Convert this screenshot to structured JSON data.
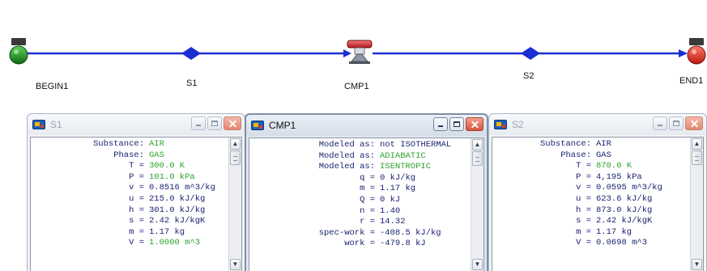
{
  "flowsheet": {
    "line_color": "#1a2fd1",
    "nodes": [
      {
        "id": "begin",
        "label": "BEGIN1",
        "icon": "source-node-icon",
        "color": "#1b7d1b"
      },
      {
        "id": "s1",
        "label": "S1",
        "icon": "state-diamond-icon"
      },
      {
        "id": "cmp1",
        "label": "CMP1",
        "icon": "compressor-icon",
        "color": "#c8202a"
      },
      {
        "id": "s2",
        "label": "S2",
        "icon": "state-diamond-icon"
      },
      {
        "id": "end",
        "label": "END1",
        "icon": "sink-node-icon",
        "color": "#d12a1a"
      }
    ]
  },
  "colors": {
    "label": "#1a2370",
    "highlight": "#2ea12e"
  },
  "windows": {
    "s1": {
      "title": "S1",
      "rows": [
        {
          "label": "Substance:",
          "value": "AIR",
          "color": "green"
        },
        {
          "label": "Phase:",
          "value": "GAS",
          "color": "green"
        },
        {
          "label": "T =",
          "value": "300.0 K",
          "color": "green"
        },
        {
          "label": "P =",
          "value": "101.0 kPa",
          "color": "green"
        },
        {
          "label": "v =",
          "value": "0.8516 m^3/kg",
          "color": "blue"
        },
        {
          "label": "u =",
          "value": "215.0 kJ/kg",
          "color": "blue"
        },
        {
          "label": "h =",
          "value": "301.0 kJ/kg",
          "color": "blue"
        },
        {
          "label": "s =",
          "value": "2.42 kJ/kgK",
          "color": "blue"
        },
        {
          "label": "m =",
          "value": "1.17 kg",
          "color": "blue"
        },
        {
          "label": "V =",
          "value": "1.0000 m^3",
          "color": "green"
        }
      ]
    },
    "cmp1": {
      "title": "CMP1",
      "rows": [
        {
          "label": "Modeled as:",
          "value": "not ISOTHERMAL",
          "color": "blue"
        },
        {
          "label": "Modeled as:",
          "value": "ADIABATIC",
          "color": "green"
        },
        {
          "label": "Modeled as:",
          "value": "ISENTROPIC",
          "color": "green"
        },
        {
          "label": "q =",
          "value": "0 kJ/kg",
          "color": "blue"
        },
        {
          "label": "m =",
          "value": "1.17 kg",
          "color": "blue"
        },
        {
          "label": "Q =",
          "value": "0 kJ",
          "color": "blue"
        },
        {
          "label": "n =",
          "value": "1.40",
          "color": "blue"
        },
        {
          "label": "r =",
          "value": "14.32",
          "color": "blue"
        },
        {
          "label": "spec-work =",
          "value": "-408.5 kJ/kg",
          "color": "blue"
        },
        {
          "label": "work =",
          "value": "-479.8 kJ",
          "color": "blue"
        }
      ]
    },
    "s2": {
      "title": "S2",
      "rows": [
        {
          "label": "Substance:",
          "value": "AIR",
          "color": "blue"
        },
        {
          "label": "Phase:",
          "value": "GAS",
          "color": "blue"
        },
        {
          "label": "T =",
          "value": "870.0 K",
          "color": "green"
        },
        {
          "label": "P =",
          "value": "4,195 kPa",
          "color": "blue"
        },
        {
          "label": "v =",
          "value": "0.0595 m^3/kg",
          "color": "blue"
        },
        {
          "label": "u =",
          "value": "623.6 kJ/kg",
          "color": "blue"
        },
        {
          "label": "h =",
          "value": "873.0 kJ/kg",
          "color": "blue"
        },
        {
          "label": "s =",
          "value": "2.42 kJ/kgK",
          "color": "blue"
        },
        {
          "label": "m =",
          "value": "1.17 kg",
          "color": "blue"
        },
        {
          "label": "V =",
          "value": "0.0698 m^3",
          "color": "blue"
        }
      ]
    }
  }
}
